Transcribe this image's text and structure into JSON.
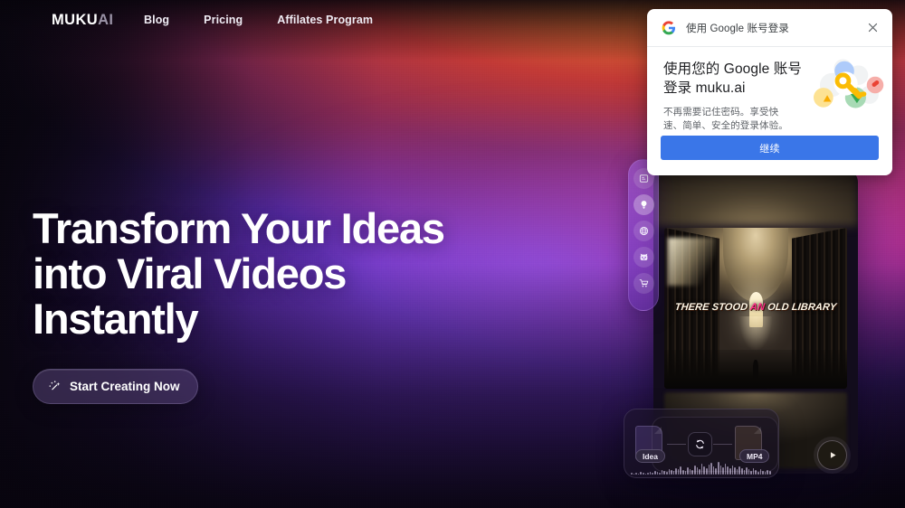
{
  "navbar": {
    "brand_primary": "MUKU",
    "brand_secondary": "AI",
    "links": [
      {
        "label": "Blog"
      },
      {
        "label": "Pricing"
      },
      {
        "label": "Affilates Program"
      }
    ]
  },
  "hero": {
    "line1": "Transform Your Ideas",
    "line2": "into Viral Videos",
    "line3": "Instantly",
    "cta_label": "Start Creating Now",
    "cta_icon": "sparkle-wand-icon"
  },
  "rail": {
    "items": [
      {
        "name": "layout-panel-icon",
        "active": false
      },
      {
        "name": "lightbulb-icon",
        "active": true
      },
      {
        "name": "globe-icon",
        "active": false
      },
      {
        "name": "robot-face-icon",
        "active": false
      },
      {
        "name": "shopping-cart-icon",
        "active": false
      }
    ]
  },
  "preview": {
    "caption_before": "THERE STOOD ",
    "caption_highlight": "AN",
    "caption_after": " OLD LIBRARY",
    "caption_highlight_color": "#ff2d88",
    "caption_text_color": "#fdf6e6"
  },
  "panel": {
    "input_chip": "Idea",
    "output_chip": "MP4",
    "convert_icon": "refresh-sync-icon",
    "play_icon": "play-icon",
    "waveform": [
      2,
      1,
      2,
      1,
      3,
      2,
      1,
      2,
      3,
      2,
      4,
      3,
      2,
      5,
      4,
      3,
      6,
      5,
      4,
      7,
      6,
      9,
      5,
      4,
      8,
      6,
      5,
      10,
      8,
      6,
      12,
      9,
      7,
      11,
      13,
      9,
      7,
      14,
      10,
      8,
      12,
      9,
      7,
      10,
      8,
      6,
      9,
      7,
      5,
      8,
      6,
      4,
      7,
      5,
      3,
      6,
      4,
      3,
      5,
      4,
      2,
      4,
      3,
      2,
      3,
      2,
      1,
      2,
      2,
      1,
      2,
      1,
      1,
      2,
      1,
      1,
      2,
      3,
      2,
      4,
      3,
      5,
      4,
      7,
      6,
      9,
      8,
      11,
      10,
      12,
      9,
      8,
      6,
      5,
      4,
      3,
      3,
      2,
      2,
      1
    ]
  },
  "google_dialog": {
    "header_title": "使用 Google 账号登录",
    "close_icon": "close-icon",
    "google_logo": "google-g-icon",
    "heading": "使用您的 Google 账号登录 muku.ai",
    "subtext": "不再需要记住密码。享受快速、简单、安全的登录体验。",
    "button_label": "继续",
    "button_color": "#3a76e8",
    "illustration": "key-with-circles-illustration"
  }
}
